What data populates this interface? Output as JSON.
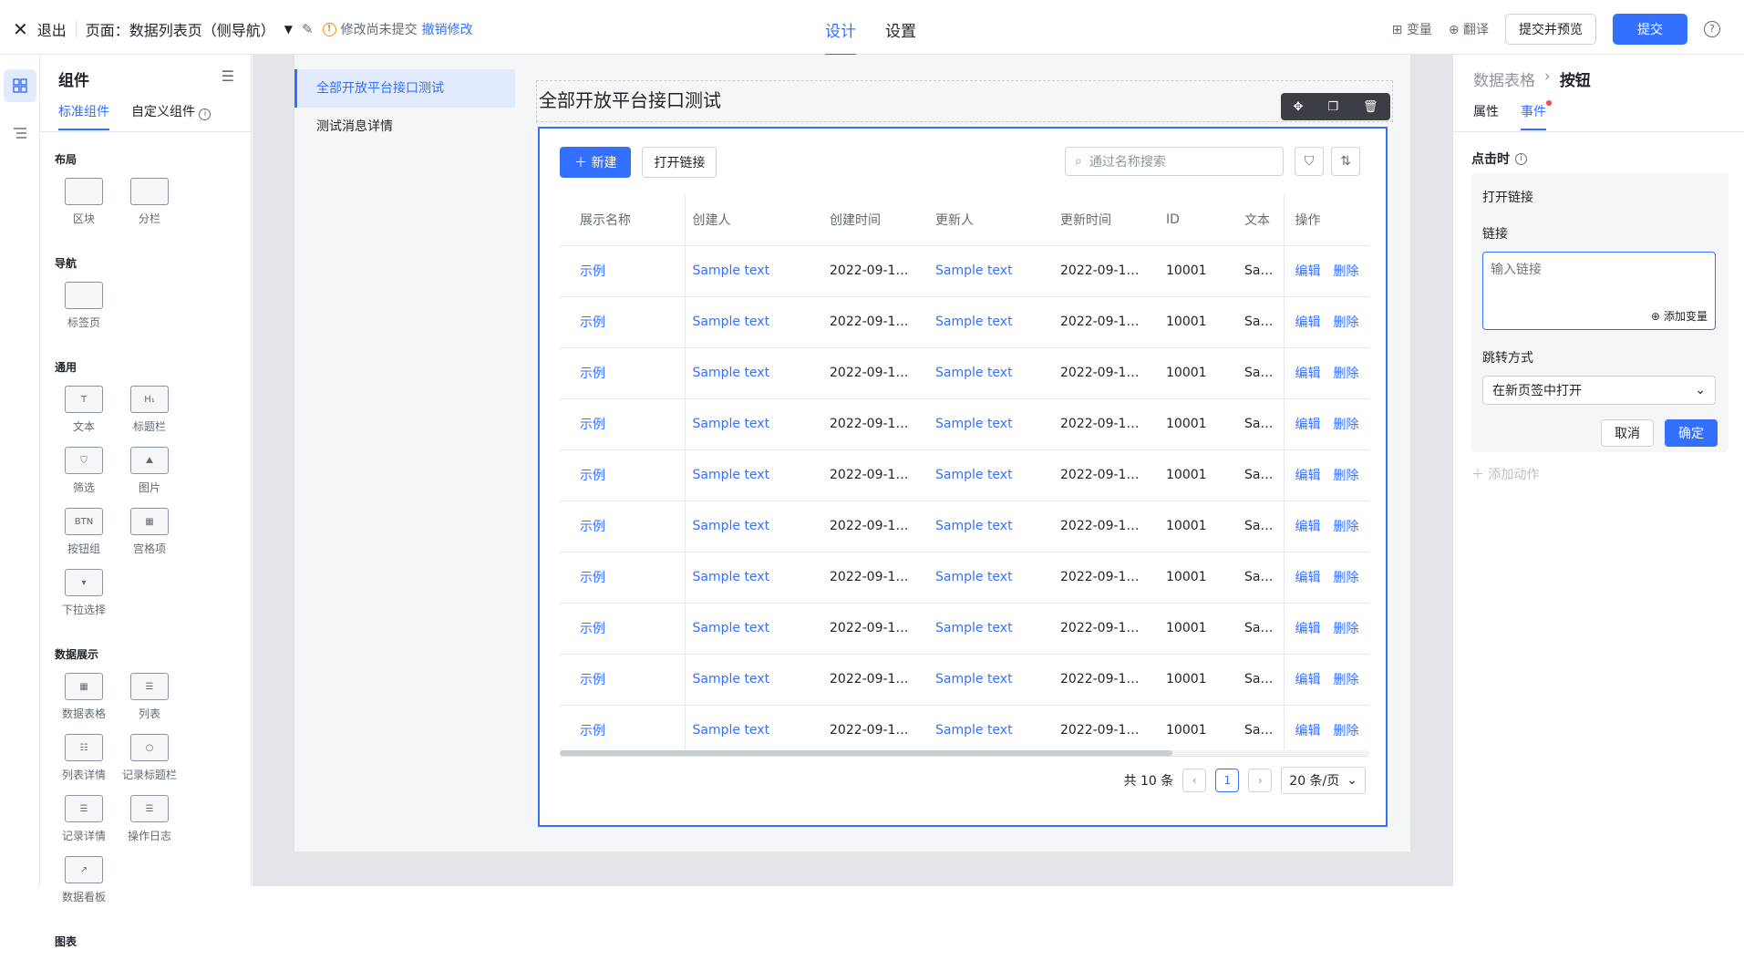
{
  "header": {
    "exit_label": "退出",
    "page_title": "页面：数据列表页（侧导航）",
    "unsaved_text": "修改尚未提交",
    "revert_label": "撤销修改",
    "tabs": [
      "设计",
      "设置"
    ],
    "variable_label": "变量",
    "translate_label": "翻译",
    "preview_label": "提交并预览",
    "submit_label": "提交",
    "help_label": "?"
  },
  "left_panel": {
    "title": "组件",
    "tabs": [
      "标准组件",
      "自定义组件"
    ],
    "sections": [
      {
        "title": "布局",
        "items": [
          {
            "label": "区块",
            "icon": "block-icon"
          },
          {
            "label": "分栏",
            "icon": "columns-icon"
          }
        ]
      },
      {
        "title": "导航",
        "items": [
          {
            "label": "标签页",
            "icon": "tabs-icon"
          }
        ]
      },
      {
        "title": "通用",
        "items": [
          {
            "label": "文本",
            "icon": "text-icon",
            "glyph": "T"
          },
          {
            "label": "标题栏",
            "icon": "heading-icon",
            "glyph": "H₁"
          },
          {
            "label": "筛选",
            "icon": "filter-icon",
            "glyph": "⛉"
          },
          {
            "label": "图片",
            "icon": "image-icon",
            "glyph": "⛰"
          },
          {
            "label": "按钮组",
            "icon": "button-group-icon",
            "glyph": "BTN"
          },
          {
            "label": "宫格项",
            "icon": "grid-item-icon",
            "glyph": "▦"
          },
          {
            "label": "下拉选择",
            "icon": "dropdown-icon",
            "glyph": "▾"
          }
        ]
      },
      {
        "title": "数据展示",
        "items": [
          {
            "label": "数据表格",
            "icon": "data-table-icon",
            "glyph": "▦"
          },
          {
            "label": "列表",
            "icon": "list-icon",
            "glyph": "☰"
          },
          {
            "label": "列表详情",
            "icon": "list-detail-icon",
            "glyph": "☷"
          },
          {
            "label": "记录标题栏",
            "icon": "record-title-icon",
            "glyph": "○"
          },
          {
            "label": "记录详情",
            "icon": "record-detail-icon",
            "glyph": "☰"
          },
          {
            "label": "操作日志",
            "icon": "operation-log-icon",
            "glyph": "☰"
          },
          {
            "label": "数据看板",
            "icon": "dashboard-icon",
            "glyph": "↗"
          }
        ]
      },
      {
        "title": "图表",
        "items": []
      }
    ]
  },
  "canvas": {
    "nav_items": [
      "全部开放平台接口测试",
      "测试消息详情"
    ],
    "content_title": "全部开放平台接口测试",
    "new_button": "新建",
    "open_link_button": "打开链接",
    "search_placeholder": "通过名称搜索",
    "columns": [
      "展示名称",
      "创建人",
      "创建时间",
      "更新人",
      "更新时间",
      "ID",
      "文本",
      "操作"
    ],
    "rows": [
      [
        "示例",
        "Sample text",
        "2022-09-16 ...",
        "Sample text",
        "2022-09-16 ...",
        "10001",
        "Sample",
        "编辑",
        "删除"
      ],
      [
        "示例",
        "Sample text",
        "2022-09-16 ...",
        "Sample text",
        "2022-09-16 ...",
        "10001",
        "Sample",
        "编辑",
        "删除"
      ],
      [
        "示例",
        "Sample text",
        "2022-09-16 ...",
        "Sample text",
        "2022-09-16 ...",
        "10001",
        "Sample",
        "编辑",
        "删除"
      ],
      [
        "示例",
        "Sample text",
        "2022-09-16 ...",
        "Sample text",
        "2022-09-16 ...",
        "10001",
        "Sample",
        "编辑",
        "删除"
      ],
      [
        "示例",
        "Sample text",
        "2022-09-16 ...",
        "Sample text",
        "2022-09-16 ...",
        "10001",
        "Sample",
        "编辑",
        "删除"
      ],
      [
        "示例",
        "Sample text",
        "2022-09-16 ...",
        "Sample text",
        "2022-09-16 ...",
        "10001",
        "Sample",
        "编辑",
        "删除"
      ],
      [
        "示例",
        "Sample text",
        "2022-09-16 ...",
        "Sample text",
        "2022-09-16 ...",
        "10001",
        "Sample",
        "编辑",
        "删除"
      ],
      [
        "示例",
        "Sample text",
        "2022-09-16 ...",
        "Sample text",
        "2022-09-16 ...",
        "10001",
        "Sample",
        "编辑",
        "删除"
      ],
      [
        "示例",
        "Sample text",
        "2022-09-16 ...",
        "Sample text",
        "2022-09-16 ...",
        "10001",
        "Sample",
        "编辑",
        "删除"
      ],
      [
        "示例",
        "Sample text",
        "2022-09-16 ...",
        "Sample text",
        "2022-09-16 ...",
        "10001",
        "Sample",
        "编辑",
        "删除"
      ]
    ],
    "pager": {
      "total": "共 10 条",
      "current_page": "1",
      "page_size": "20 条/页"
    }
  },
  "right_panel": {
    "breadcrumb": [
      "数据表格",
      "按钮"
    ],
    "tabs": [
      "属性",
      "事件"
    ],
    "on_click_label": "点击时",
    "action_title": "打开链接",
    "link_label": "链接",
    "link_placeholder": "输入链接",
    "add_variable_label": "添加变量",
    "jump_label": "跳转方式",
    "jump_value": "在新页签中打开",
    "cancel_label": "取消",
    "confirm_label": "确定",
    "add_action_label": "添加动作"
  },
  "colors": {
    "accent": "#3370ff",
    "warning": "#ff8800",
    "canvas_bg": "#e4e5e8"
  }
}
